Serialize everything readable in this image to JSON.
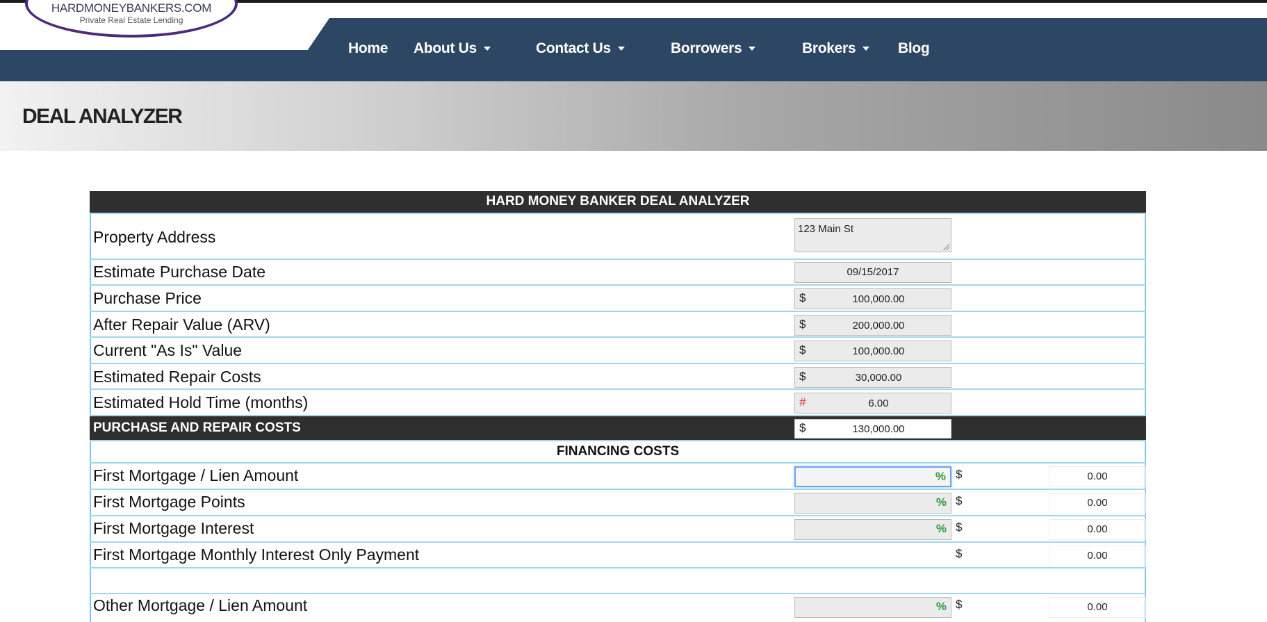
{
  "header": {
    "logo_title": "HARDMONEYBANKERS.COM",
    "logo_subtitle": "Private Real Estate Lending",
    "nav": [
      {
        "label": "Home"
      },
      {
        "label": "About Us"
      },
      {
        "label": "Contact Us"
      },
      {
        "label": "Borrowers"
      },
      {
        "label": "Brokers"
      },
      {
        "label": "Blog"
      }
    ]
  },
  "page_title": "DEAL ANALYZER",
  "analyzer": {
    "title": "HARD MONEY BANKER DEAL ANALYZER",
    "rows": [
      {
        "label": "Property Address",
        "value": "123 Main St"
      },
      {
        "label": "Estimate Purchase Date",
        "value": "09/15/2017"
      },
      {
        "label": "Purchase Price",
        "symbol": "$",
        "value": "100,000.00"
      },
      {
        "label": "After Repair Value (ARV)",
        "symbol": "$",
        "value": "200,000.00"
      },
      {
        "label": "Current \"As Is\" Value",
        "symbol": "$",
        "value": "100,000.00"
      },
      {
        "label": "Estimated Repair Costs",
        "symbol": "$",
        "value": "30,000.00"
      },
      {
        "label": "Estimated Hold Time (months)",
        "symbol": "#",
        "value": "6.00"
      }
    ],
    "purchase_repair": {
      "label": "PURCHASE AND REPAIR COSTS",
      "symbol": "$",
      "value": "130,000.00"
    },
    "financing_header": "FINANCING COSTS",
    "financing_rows": [
      {
        "label": "First Mortgage / Lien Amount",
        "pct": "%",
        "symbol": "$",
        "amount": "0.00"
      },
      {
        "label": "First Mortgage Points",
        "pct": "%",
        "symbol": "$",
        "amount": "0.00"
      },
      {
        "label": "First Mortgage Interest",
        "pct": "%",
        "symbol": "$",
        "amount": "0.00"
      },
      {
        "label": "First Mortgage Monthly Interest Only Payment",
        "symbol": "$",
        "amount": "0.00"
      },
      {
        "label": "Other Mortgage / Lien Amount",
        "pct": "%",
        "symbol": "$",
        "amount": "0.00"
      }
    ]
  }
}
